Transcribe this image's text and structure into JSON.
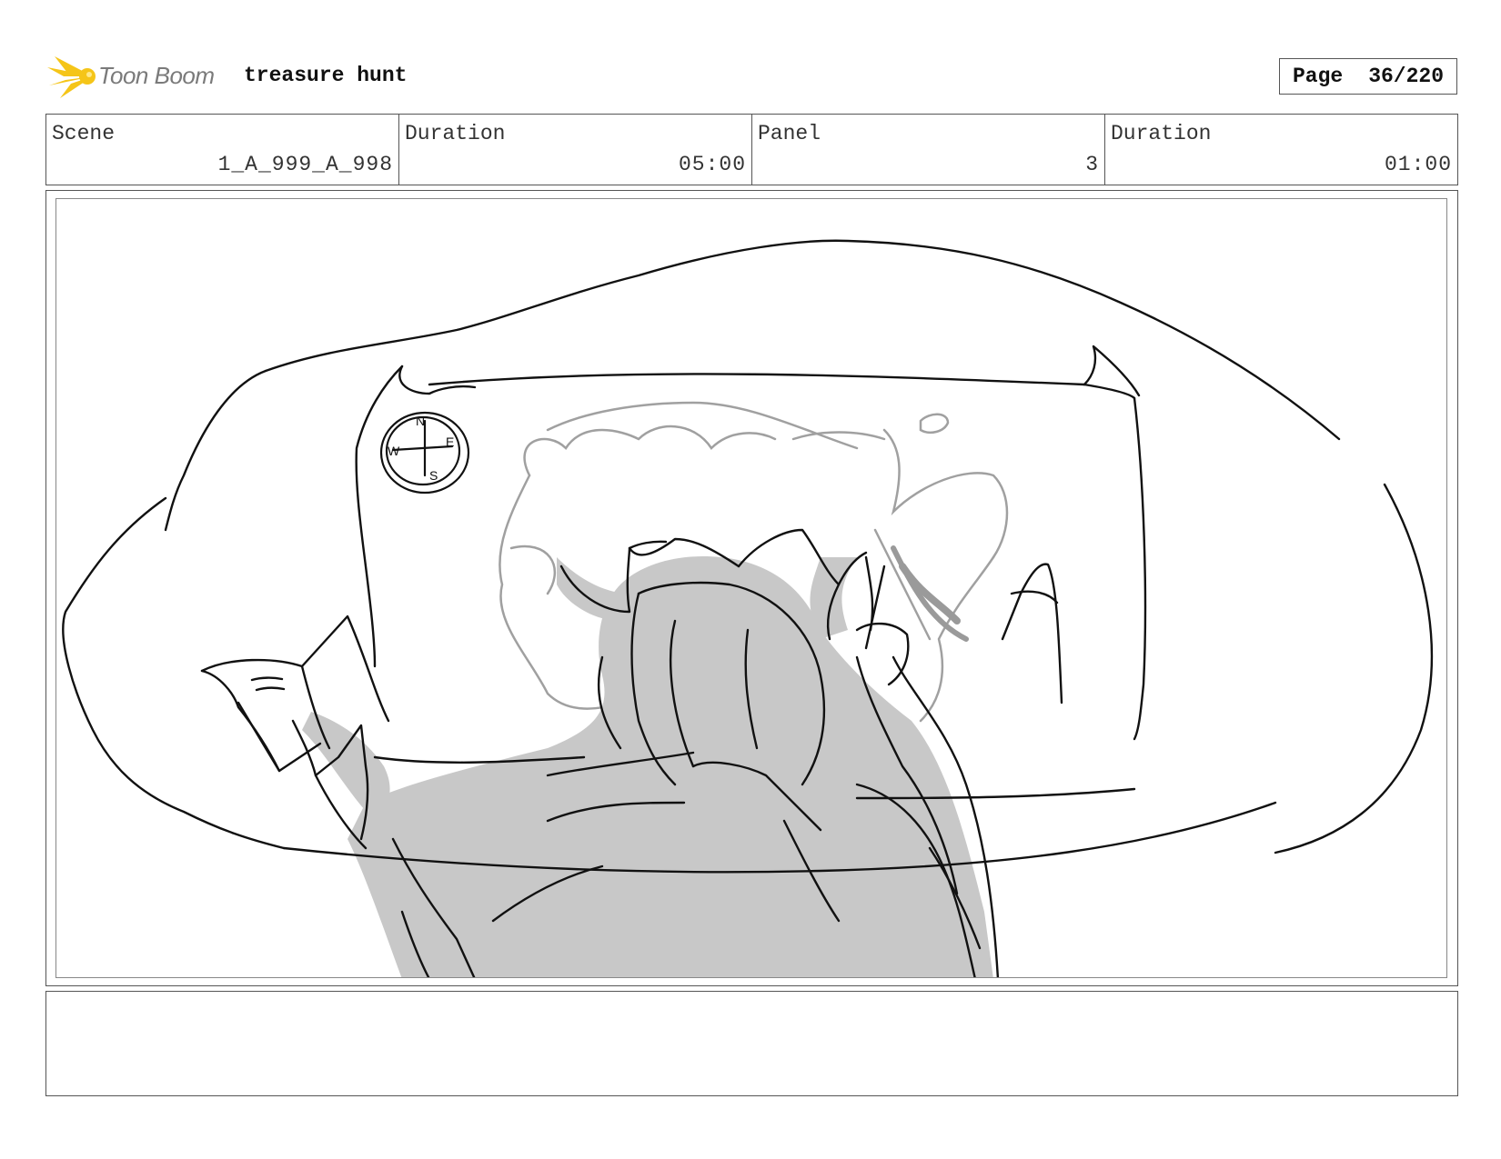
{
  "header": {
    "logo_text": "Toon Boom",
    "project_title": "treasure hunt",
    "page_label": "Page",
    "page_number": "36/220"
  },
  "info": {
    "scene_label": "Scene",
    "scene_value": "1_A_999_A_998",
    "scene_duration_label": "Duration",
    "scene_duration_value": "05:00",
    "panel_label": "Panel",
    "panel_value": "3",
    "panel_duration_label": "Duration",
    "panel_duration_value": "01:00"
  },
  "sketch": {
    "compass_letters": [
      "N",
      "E",
      "S",
      "W"
    ]
  },
  "notes": {
    "text": ""
  },
  "colors": {
    "logo_burst": "#f5c518",
    "line": "#111111",
    "shade": "#c8c8c8",
    "map_line": "#a0a0a0"
  }
}
